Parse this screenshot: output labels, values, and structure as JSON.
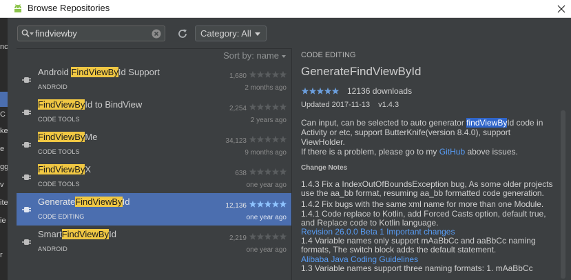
{
  "window": {
    "title": "Browse Repositories"
  },
  "strip": {
    "fragments": [
      "nc",
      "C",
      "ke",
      "e",
      "gg",
      "v",
      "ite",
      "ie",
      "r"
    ]
  },
  "toolbar": {
    "search_value": "findviewby",
    "category_label": "Category: All"
  },
  "list": {
    "sort_label": "Sort by: name",
    "rows": [
      {
        "name_pre": "Android ",
        "name_mark": "FindViewBy",
        "name_post": "Id Support",
        "category": "ANDROID",
        "downloads": "1,680",
        "rating": 0,
        "date": "2 months ago",
        "selected": false
      },
      {
        "name_pre": "",
        "name_mark": "FindViewBy",
        "name_post": "Id to BindView",
        "category": "CODE TOOLS",
        "downloads": "2,254",
        "rating": 0,
        "date": "2 years ago",
        "selected": false
      },
      {
        "name_pre": "",
        "name_mark": "FindViewBy",
        "name_post": "Me",
        "category": "CODE TOOLS",
        "downloads": "34,123",
        "rating": 0,
        "date": "9 months ago",
        "selected": false
      },
      {
        "name_pre": "",
        "name_mark": "FindViewBy",
        "name_post": "X",
        "category": "CODE TOOLS",
        "downloads": "638",
        "rating": 0,
        "date": "one year ago",
        "selected": false
      },
      {
        "name_pre": "Generate",
        "name_mark": "FindViewBy",
        "name_post": "Id",
        "category": "CODE EDITING",
        "downloads": "12,136",
        "rating": 5,
        "date": "one year ago",
        "selected": true
      },
      {
        "name_pre": "Smart",
        "name_mark": "FindViewBy",
        "name_post": "Id",
        "category": "ANDROID",
        "downloads": "2,219",
        "rating": 0,
        "date": "one year ago",
        "selected": false
      }
    ]
  },
  "detail": {
    "category": "CODE EDITING",
    "title": "GenerateFindViewById",
    "rating": 5,
    "downloads": "12136 downloads",
    "updated": "Updated 2017-11-13",
    "version": "v1.4.3",
    "desc_pre": "Can input, can be selected to auto generator ",
    "desc_sel": "findViewBy",
    "desc_post": "Id code in Activity or etc, support ButterKnife(version 8.4.0), support ViewHolder.",
    "desc2_pre": "If there is a problem, please go to my ",
    "desc2_link": "GitHub",
    "desc2_post": " above issues.",
    "notes_heading": "Change Notes",
    "note1": "1.4.3 Fix a IndexOutOfBoundsException bug, As some older projects use the aa_bb format, resuming aa_bb formatted code generation.",
    "note2": "1.4.2 Fix bugs with the same xml name for more than one Module.",
    "note3": "1.4.1 Code replace to Kotlin, add Forced Casts option, default true, and Replace code to Kotlin language.",
    "note3_link": "Revision 26.0.0 Beta 1 Important changes",
    "note4": "1.4 Variable names only support mAaBbCc and aaBbCc naming formats, The switch block adds the default statement.",
    "note4_link": "Alibaba Java Coding Guidelines",
    "note5": "1.3 Variable names support three naming formats: 1. mAaBbCc"
  },
  "colors": {
    "accent": "#4b6eaf",
    "highlight": "#f0c743",
    "link": "#589df6",
    "star": "#6b9edc"
  }
}
